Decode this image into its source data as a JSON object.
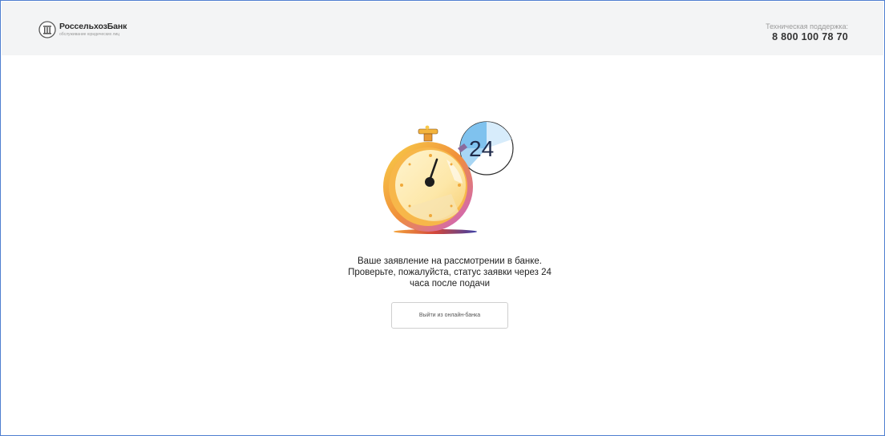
{
  "header": {
    "logo": {
      "name": "РоссельхозБанк",
      "tagline": "обслуживание юридических лиц"
    },
    "support": {
      "label": "Техническая поддержка:",
      "phone": "8 800 100 78 70"
    }
  },
  "main": {
    "illustration": {
      "icon": "stopwatch-icon",
      "badge_text": "24"
    },
    "message_lines": [
      "Ваше заявление на рассмотрении в банке.",
      "Проверьте, пожалуйста, статус заявки через 24",
      "часа после подачи"
    ],
    "logout_button_label": "Выйти из онлайн-банка"
  },
  "colors": {
    "window_border": "#4f7fd0",
    "header_bg": "#f3f4f5",
    "badge_blue": "#7fc2ee",
    "stopwatch_gold": "#f3b43d"
  }
}
